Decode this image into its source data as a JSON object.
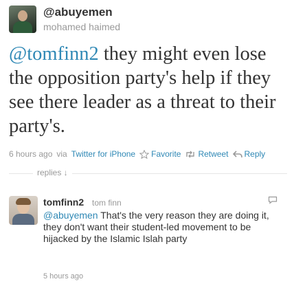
{
  "tweet": {
    "username": "@abuyemen",
    "full_name": "mohamed haimed",
    "mention": "@tomfinn2",
    "text_rest": " they might even lose the opposition party's help if they see there leader as a threat to their party's.",
    "timestamp": "6 hours ago",
    "via": "via",
    "source": "Twitter for iPhone",
    "actions": {
      "favorite": "Favorite",
      "retweet": "Retweet",
      "reply": "Reply"
    }
  },
  "replies_label": "replies ↓",
  "reply": {
    "username": "tomfinn2",
    "full_name": "tom finn",
    "mention": "@abuyemen",
    "text_rest": " That's the very reason they are doing it, they don't want their student-led movement to be hijacked by the Islamic Islah party",
    "timestamp": "5 hours ago"
  },
  "colors": {
    "link": "#2f88b5",
    "muted": "#999999",
    "text": "#333333"
  },
  "icons": {
    "favorite": "star-icon",
    "retweet": "retweet-icon",
    "reply": "reply-arrow-icon",
    "reply_action": "speech-bubble-icon"
  }
}
